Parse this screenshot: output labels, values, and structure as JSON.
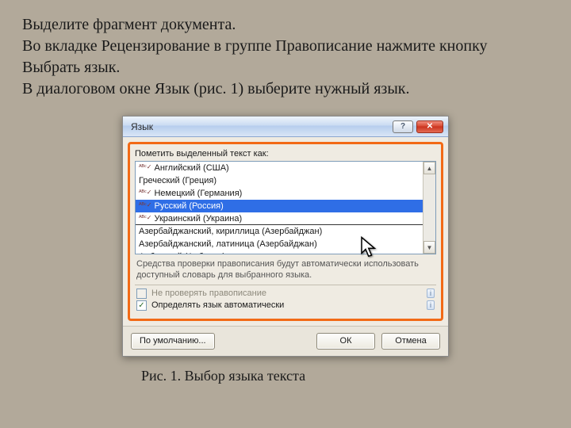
{
  "instructions": {
    "line1": "Выделите фрагмент документа.",
    "line2": "Во вкладке Рецензирование в группе Правописание нажмите кнопку Выбрать язык.",
    "line3": " В диалоговом окне Язык (рис. 1) выберите нужный язык."
  },
  "dialog": {
    "title": "Язык",
    "help_glyph": "?",
    "close_glyph": "✕",
    "label_mark": "Пометить выделенный текст как:",
    "languages": [
      {
        "name": "Английский (США)",
        "spell": true
      },
      {
        "name": "Греческий (Греция)",
        "spell": false
      },
      {
        "name": "Немецкий (Германия)",
        "spell": true
      },
      {
        "name": "Русский (Россия)",
        "spell": true,
        "selected": true
      },
      {
        "name": "Украинский (Украина)",
        "spell": true,
        "divider_after": true
      },
      {
        "name": "Азербайджанский, кириллица (Азербайджан)",
        "spell": false
      },
      {
        "name": "Азербайджанский, латиница (Азербайджан)",
        "spell": false
      },
      {
        "name": "Албанский (Албания)",
        "spell": false
      }
    ],
    "note": "Средства проверки правописания будут автоматически использовать доступный словарь для выбранного языка.",
    "check_no_spell": "Не проверять правописание",
    "check_detect": "Определять язык автоматически",
    "info_badge": "i",
    "scroll_up": "▲",
    "scroll_down": "▼",
    "btn_default": "По умолчанию...",
    "btn_ok": "ОК",
    "btn_cancel": "Отмена"
  },
  "caption": "Рис. 1. Выбор языка текста"
}
